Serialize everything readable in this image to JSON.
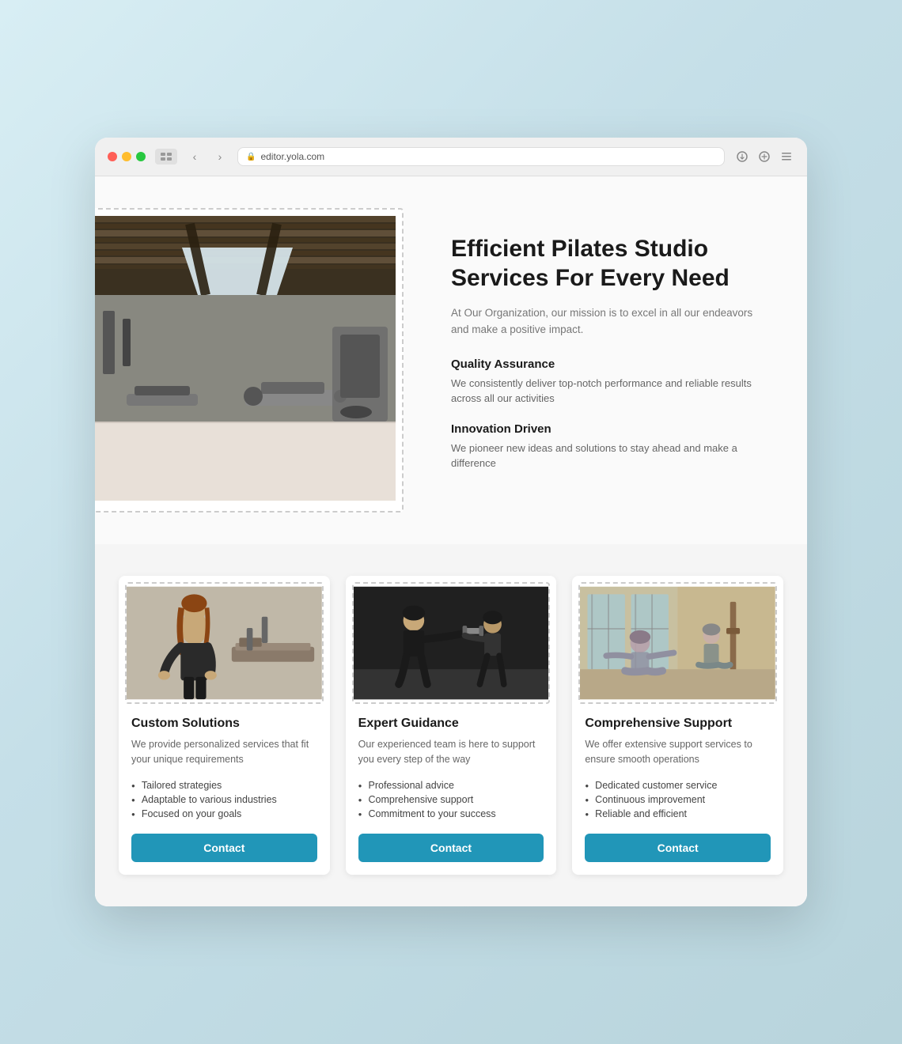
{
  "browser": {
    "url": "editor.yola.com",
    "back_label": "‹",
    "forward_label": "›"
  },
  "hero": {
    "title": "Efficient Pilates Studio Services For Every Need",
    "subtitle": "At Our Organization, our mission is to excel in all our endeavors and make a positive impact.",
    "features": [
      {
        "title": "Quality Assurance",
        "desc": "We consistently deliver top-notch performance and reliable results across all our activities"
      },
      {
        "title": "Innovation Driven",
        "desc": "We pioneer new ideas and solutions to stay ahead and make a difference"
      }
    ]
  },
  "cards": [
    {
      "title": "Custom Solutions",
      "desc": "We provide personalized services that fit your unique requirements",
      "bullets": [
        "Tailored strategies",
        "Adaptable to various industries",
        "Focused on your goals"
      ],
      "button": "Contact"
    },
    {
      "title": "Expert Guidance",
      "desc": "Our experienced team is here to support you every step of the way",
      "bullets": [
        "Professional advice",
        "Comprehensive support",
        "Commitment to your success"
      ],
      "button": "Contact"
    },
    {
      "title": "Comprehensive Support",
      "desc": "We offer extensive support services to ensure smooth operations",
      "bullets": [
        "Dedicated customer service",
        "Continuous improvement",
        "Reliable and efficient"
      ],
      "button": "Contact"
    }
  ]
}
